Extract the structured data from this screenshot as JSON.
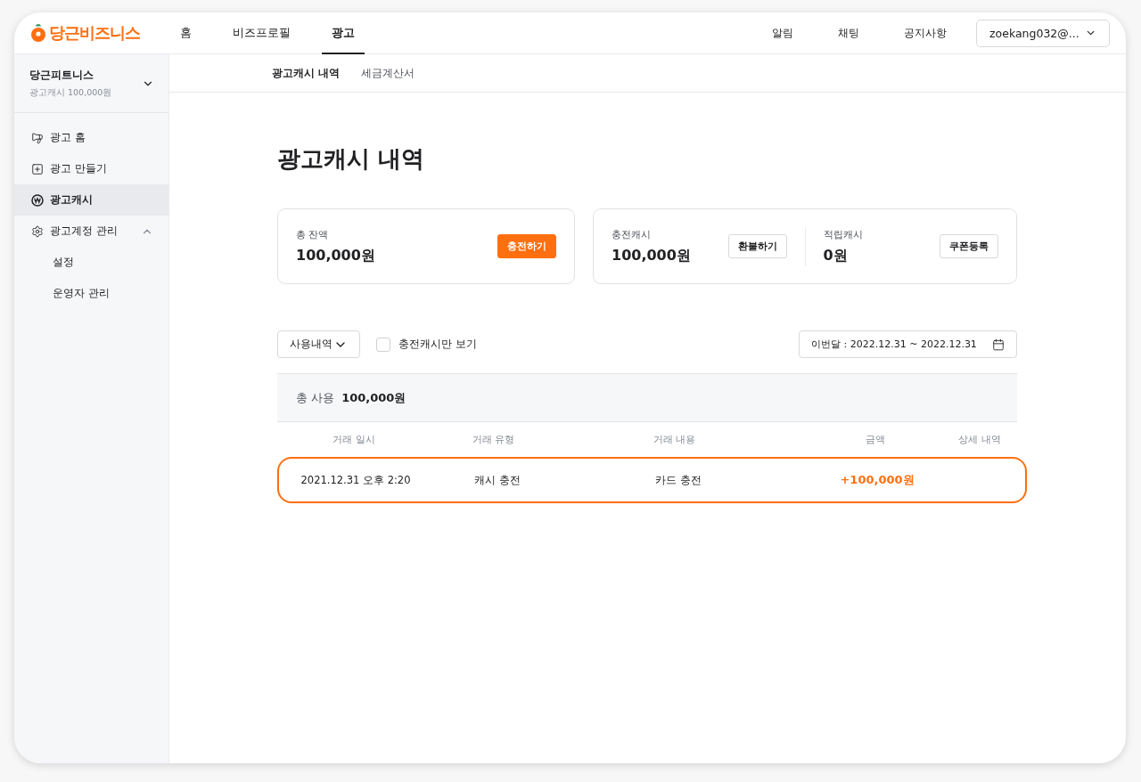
{
  "header": {
    "logo": "당근비즈니스",
    "nav": [
      {
        "label": "홈",
        "selected": false
      },
      {
        "label": "비즈프로필",
        "selected": false
      },
      {
        "label": "광고",
        "selected": true
      }
    ],
    "links": [
      "알림",
      "채팅",
      "공지사항"
    ],
    "account": "zoekang032@..."
  },
  "sidebar": {
    "business": {
      "name": "당근피트니스",
      "cash": "광고캐시 100,000원"
    },
    "items": [
      {
        "label": "광고 홈",
        "kind": "megaphone",
        "selected": false
      },
      {
        "label": "광고 만들기",
        "kind": "plus",
        "selected": false
      },
      {
        "label": "광고캐시",
        "kind": "won",
        "selected": true
      },
      {
        "label": "광고계정 관리",
        "kind": "gear",
        "selected": false,
        "expanded": true,
        "children": [
          {
            "label": "설정",
            "selected": false
          },
          {
            "label": "운영자 관리",
            "selected": false
          }
        ]
      }
    ]
  },
  "subtabs": [
    {
      "label": "광고캐시 내역",
      "selected": true
    },
    {
      "label": "세금계산서",
      "selected": false
    }
  ],
  "title": "광고캐시 내역",
  "balance": {
    "label": "총 잔액",
    "amount": "100,000원",
    "button": "충전하기"
  },
  "cash": [
    {
      "label": "충전캐시",
      "amount": "100,000원",
      "button": "환불하기"
    },
    {
      "label": "적립캐시",
      "amount": "0원",
      "button": "쿠폰등록"
    }
  ],
  "filters": {
    "dropdown": "사용내역",
    "checkbox": {
      "label": "충전캐시만 보기",
      "checked": false
    },
    "date": "이번달 : 2022.12.31 ~ 2022.12.31"
  },
  "summary": {
    "label": "총 사용",
    "amount": "100,000원"
  },
  "table": {
    "columns": [
      "거래 일시",
      "거래 유형",
      "거래 내용",
      "금액",
      "상세 내역"
    ],
    "rows": [
      {
        "cells": [
          "2021.12.31 오후 2:20",
          "캐시 충전",
          "카드 충전",
          "+100,000원"
        ],
        "highlighted": true
      }
    ]
  }
}
